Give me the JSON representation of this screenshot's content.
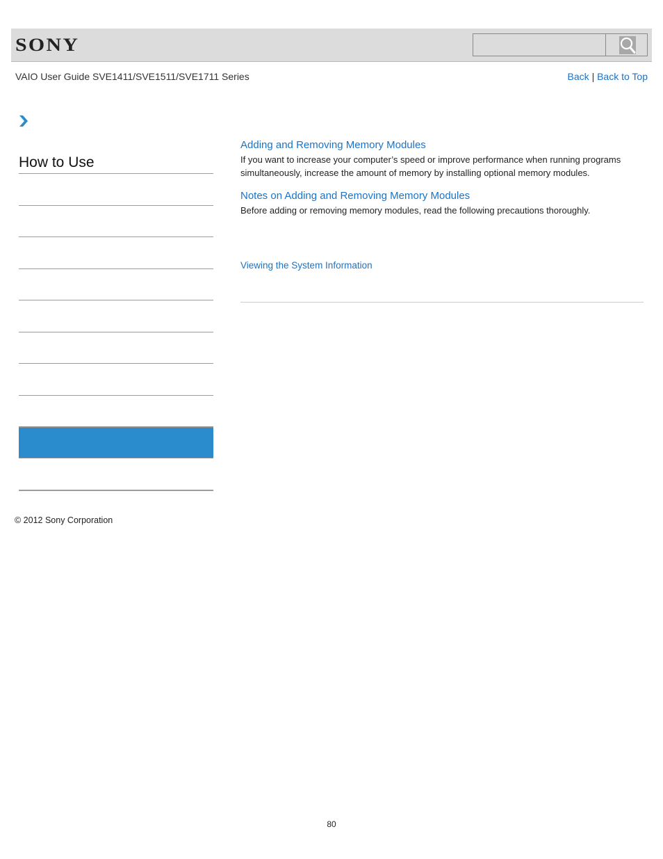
{
  "header": {
    "logo": "SONY",
    "search": {
      "value": "",
      "placeholder": "",
      "icon": "search-icon"
    }
  },
  "subheader": {
    "guide_title": "VAIO User Guide SVE1411/SVE1511/SVE1711 Series",
    "back_label": "Back",
    "separator": "|",
    "back_to_top_label": "Back to Top"
  },
  "sidebar": {
    "breadcrumb_icon": "chevron-right-icon",
    "title": "How to Use",
    "items": [
      {
        "label": "",
        "active": false
      },
      {
        "label": "",
        "active": false
      },
      {
        "label": "",
        "active": false
      },
      {
        "label": "",
        "active": false
      },
      {
        "label": "",
        "active": false
      },
      {
        "label": "",
        "active": false
      },
      {
        "label": "",
        "active": false
      },
      {
        "label": "",
        "active": true
      },
      {
        "label": "",
        "active": false
      }
    ],
    "active_color": "#2a8ccc"
  },
  "main": {
    "sections": [
      {
        "title": "Adding and Removing Memory Modules",
        "description": "If you want to increase your computer’s speed or improve performance when running programs simultaneously, increase the amount of memory by installing optional memory modules."
      },
      {
        "title": "Notes on Adding and Removing Memory Modules",
        "description": "Before adding or removing memory modules, read the following precautions thoroughly."
      }
    ],
    "related_link": "Viewing the System Information",
    "link_color": "#1a73c7"
  },
  "footer": {
    "copyright": "© 2012 Sony Corporation",
    "page_number": "80"
  }
}
